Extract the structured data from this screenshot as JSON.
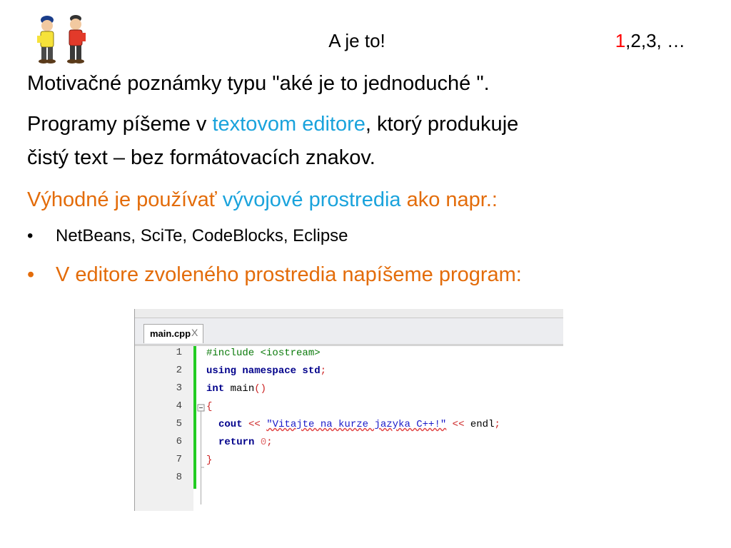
{
  "header": {
    "title": "A je to!",
    "counter_first": "1",
    "counter_rest": ",2,3, …"
  },
  "body": {
    "line1": "Motivačné poznámky typu \"aké je to jednoduché \".",
    "line2_a": "Programy píšeme v ",
    "line2_link": "textovom editore",
    "line2_b": ", ktorý produkuje",
    "line3": "čistý  text – bez formátovacích znakov.",
    "line4_a": "Výhodné je používať ",
    "line4_b": "vývojové prostredia",
    "line4_c": " ako napr.:",
    "bullet1": "NetBeans, SciTe, CodeBlocks, Eclipse",
    "bullet2": "V editore zvoleného prostredia napíšeme program:",
    "bullet_symbol": "•"
  },
  "editor": {
    "tab_name": "main.cpp",
    "tab_close": "X",
    "line_numbers": [
      "1",
      "2",
      "3",
      "4",
      "5",
      "6",
      "7",
      "8"
    ],
    "code": {
      "l1": "#include <iostream>",
      "l2_kw": "using namespace std",
      "l2_semi": ";",
      "l3_kw": "int",
      "l3_fn": " main",
      "l3_paren": "()",
      "l4": "{",
      "l5_kw": "cout",
      "l5_op1": " << ",
      "l5_str": "\"Vitajte na kurze jazyka C++!\"",
      "l5_op2": " << ",
      "l5_end": "endl",
      "l5_semi": ";",
      "l6_kw": "return",
      "l6_num": " 0",
      "l6_semi": ";",
      "l7": "}"
    }
  },
  "colors": {
    "orange": "#e36c0a",
    "blue": "#1aa3dc",
    "red": "#ff0000",
    "editor_green": "#22cc22"
  }
}
